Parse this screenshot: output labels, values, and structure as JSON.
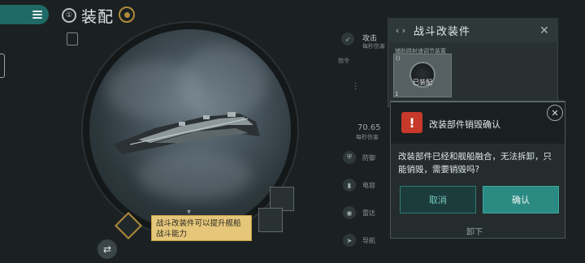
{
  "header": {
    "title": "装配",
    "title_icon_glyph": "①"
  },
  "stats": {
    "attack_label": "攻击",
    "attack_sub": "每秒伤害",
    "position_label": "指令",
    "dps_value": "70.65",
    "dps_sub": "每秒伤害",
    "rows": [
      {
        "label": "防御",
        "icon": "shield-icon"
      },
      {
        "label": "电容",
        "icon": "battery-icon"
      },
      {
        "label": "雷达",
        "icon": "radar-icon"
      },
      {
        "label": "导航",
        "icon": "navigation-icon"
      }
    ]
  },
  "module_panel": {
    "title": "战斗改装件",
    "brace_glyph": "‹ ›",
    "subtitle": "辅助跳射速调节装置",
    "card_corner": "()",
    "equipped_label": "已装配",
    "card_number": "1"
  },
  "tooltip": {
    "text": "战斗改装件可以提升舰船战斗能力"
  },
  "dialog": {
    "title": "改装部件销毁确认",
    "warning_glyph": "!",
    "body": "改装部件已经和舰船融合，无法拆卸，只能销毁，需要销毁吗?",
    "cancel_label": "取消",
    "confirm_label": "确认"
  },
  "footer": {
    "unload_label": "卸下"
  },
  "colors": {
    "accent": "#2b8a82",
    "warning": "#c6392b",
    "tooltip_bg": "#e6c77a",
    "gold": "#b08a3a"
  }
}
